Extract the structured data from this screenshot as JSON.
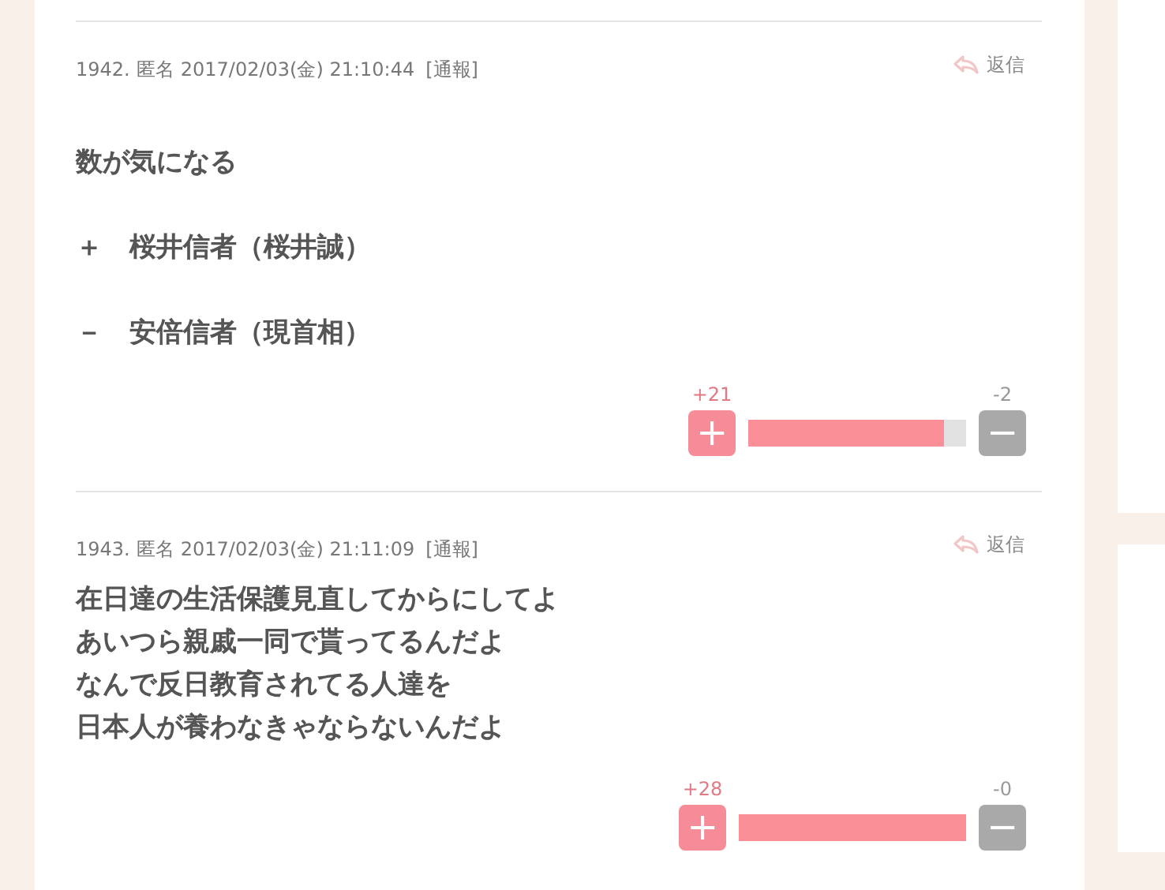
{
  "comments": [
    {
      "number": "1942.",
      "author": "匿名",
      "date": "2017/02/03(金) 21:10:44",
      "report": "[通報]",
      "reply": "返信",
      "paragraphs": [
        [
          "数が気になる"
        ],
        [
          "＋　桜井信者（桜井誠）"
        ],
        [
          "－　安倍信者（現首相）"
        ]
      ],
      "plus_count": "+21",
      "minus_count": "-2",
      "plus_label": "+",
      "minus_label": "−",
      "level": 0.9
    },
    {
      "number": "1943.",
      "author": "匿名",
      "date": "2017/02/03(金) 21:11:09",
      "report": "[通報]",
      "reply": "返信",
      "paragraphs": [
        [
          "在日達の生活保護見直してからにしてよ",
          "あいつら親戚一同で貰ってるんだよ",
          "なんで反日教育されてる人達を",
          "日本人が養わなきゃならないんだよ"
        ]
      ],
      "plus_count": "+28",
      "minus_count": "-0",
      "plus_label": "+",
      "minus_label": "−",
      "level": 1
    }
  ],
  "sidebar": {
    "panels": [
      {
        "kind": "panel"
      },
      {
        "kind": "panel"
      }
    ]
  }
}
